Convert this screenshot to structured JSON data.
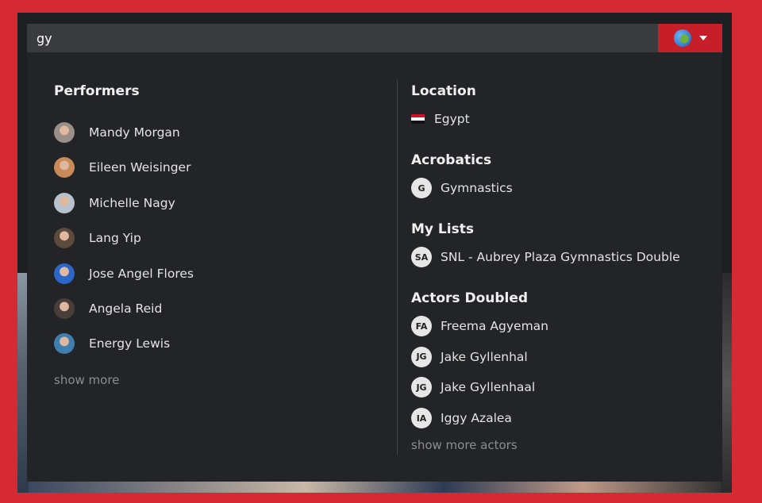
{
  "search": {
    "value": "gy"
  },
  "location_button": {
    "icon": "globe-icon",
    "accent": "#c71f29"
  },
  "performers": {
    "title": "Performers",
    "items": [
      {
        "name": "Mandy Morgan",
        "avatar": "#9a8f88"
      },
      {
        "name": "Eileen Weisinger",
        "avatar": "#c98a5a"
      },
      {
        "name": "Michelle Nagy",
        "avatar": "#b7c2cc"
      },
      {
        "name": "Lang Yip",
        "avatar": "#5c4a3c"
      },
      {
        "name": "Jose Angel Flores",
        "avatar": "#2c66c8"
      },
      {
        "name": "Angela Reid",
        "avatar": "#4a3e3a"
      },
      {
        "name": "Energy Lewis",
        "avatar": "#3f7fb0"
      }
    ],
    "show_more": "show more"
  },
  "location": {
    "title": "Location",
    "items": [
      {
        "name": "Egypt"
      }
    ]
  },
  "acrobatics": {
    "title": "Acrobatics",
    "items": [
      {
        "initials": "G",
        "name": "Gymnastics"
      }
    ]
  },
  "my_lists": {
    "title": "My Lists",
    "items": [
      {
        "initials": "SA",
        "name": "SNL - Aubrey Plaza Gymnastics Double"
      }
    ]
  },
  "actors_doubled": {
    "title": "Actors Doubled",
    "items": [
      {
        "initials": "FA",
        "name": "Freema Agyeman"
      },
      {
        "initials": "JG",
        "name": "Jake Gyllenhal"
      },
      {
        "initials": "JG",
        "name": "Jake Gyllenhaal"
      },
      {
        "initials": "IA",
        "name": "Iggy Azalea"
      }
    ],
    "show_more": "show more actors"
  }
}
